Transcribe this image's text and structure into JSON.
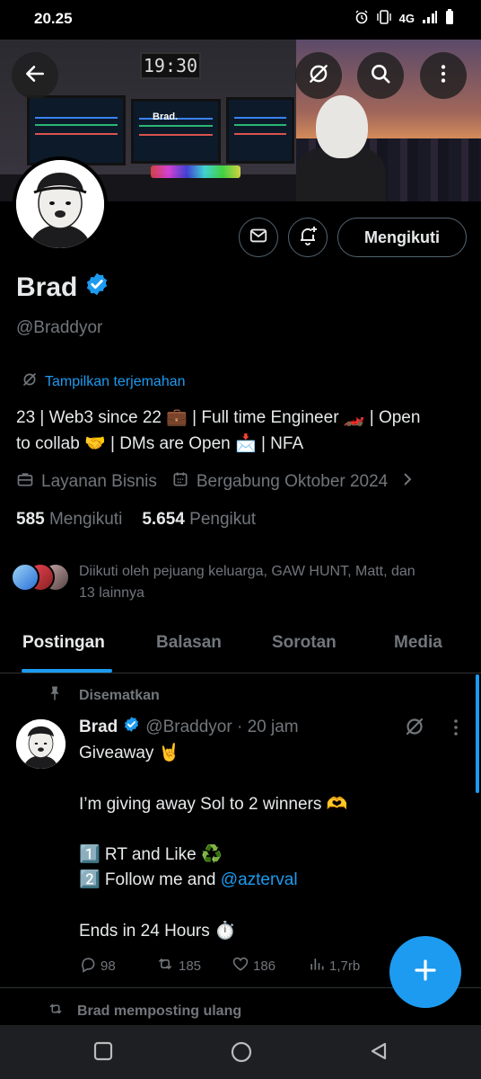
{
  "status_bar": {
    "time": "20.25",
    "network": "4G"
  },
  "banner": {
    "clock": "19:30",
    "tag": "Brad."
  },
  "profile": {
    "name": "Brad",
    "handle": "@Braddyor",
    "follow_label": "Mengikuti",
    "translate_label": "Tampilkan terjemahan",
    "bio_line1": "23 | Web3 since 22 💼 | Full time Engineer 🏎️ | Open",
    "bio_line2": "to collab 🤝 | DMs are Open 📩 | NFA",
    "business": "Layanan Bisnis",
    "joined": "Bergabung Oktober 2024",
    "following_count": "585",
    "following_label": "Mengikuti",
    "followers_count": "5.654",
    "followers_label": "Pengikut",
    "followed_by_line1": "Diikuti oleh pejuang keluarga, GAW HUNT, Matt, dan",
    "followed_by_line2": "13 lainnya"
  },
  "tabs": [
    "Postingan",
    "Balasan",
    "Sorotan",
    "Media"
  ],
  "pinned_post": {
    "pinned_label": "Disematkan",
    "author": "Brad",
    "handle_time": "@Braddyor · 20 jam",
    "line1": "Giveaway 🤘",
    "line2": "I’m giving away Sol to 2 winners 🫶",
    "line3": "1️⃣ RT and Like ♻️",
    "line4_prefix": "2️⃣ Follow me and ",
    "line4_mention": "@azterval",
    "line5": "Ends in 24 Hours ⏱️",
    "replies": "98",
    "reposts": "185",
    "likes": "186",
    "views": "1,7rb"
  },
  "next_post": {
    "repost_label": "Brad memposting ulang"
  },
  "colors": {
    "accent": "#1d9bf0",
    "muted": "#71767b",
    "text": "#e7e9ea",
    "border": "#2f3336"
  }
}
